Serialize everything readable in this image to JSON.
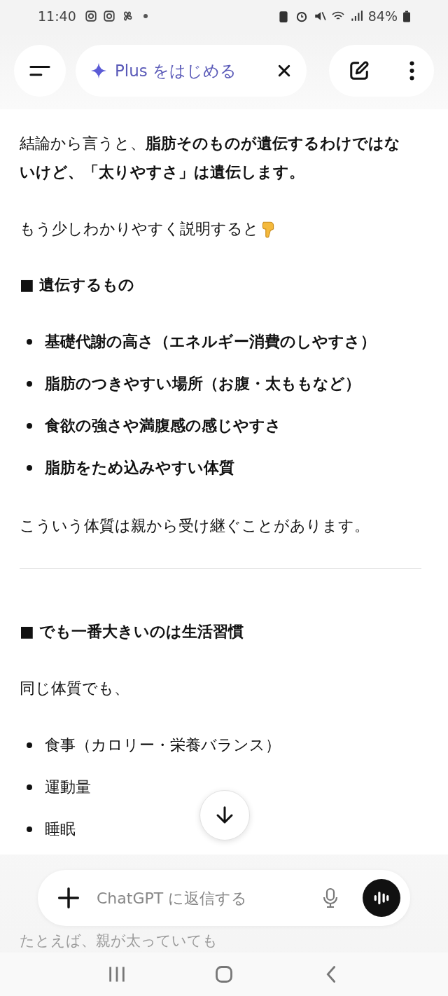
{
  "status_bar": {
    "time": "11:40",
    "battery": "84%"
  },
  "header": {
    "upgrade_label": "Plus をはじめる"
  },
  "blocks": [
    {
      "kind": "paragraph",
      "text": "結論から言うと、**脂肪そのものが遺伝するわけではないけど、「太りやすさ」は遺伝します。**",
      "pointer": false
    },
    {
      "kind": "paragraph",
      "text": "もう少しわかりやすく説明すると",
      "pointer": true
    },
    {
      "kind": "heading",
      "text": "■ 遺伝するもの"
    },
    {
      "kind": "bullets",
      "bold": true,
      "items": [
        "基礎代謝の高さ（エネルギー消費のしやすさ）",
        "脂肪のつきやすい場所（お腹・太ももなど）",
        "食欲の強さや満腹感の感じやすさ",
        "脂肪をため込みやすい体質"
      ]
    },
    {
      "kind": "paragraph",
      "text": "こういう体質は親から受け継ぐことがあります。",
      "pointer": false
    },
    {
      "kind": "divider"
    },
    {
      "kind": "heading",
      "text": "■ でも一番大きいのは生活習慣"
    },
    {
      "kind": "paragraph",
      "text": "同じ体質でも、",
      "pointer": false
    },
    {
      "kind": "bullets",
      "bold": false,
      "items": [
        "食事（カロリー・栄養バランス）",
        "運動量",
        "睡眠"
      ]
    }
  ],
  "faded_line": "たとえば、親が太っていても",
  "composer": {
    "placeholder": "ChatGPT に返信する"
  }
}
